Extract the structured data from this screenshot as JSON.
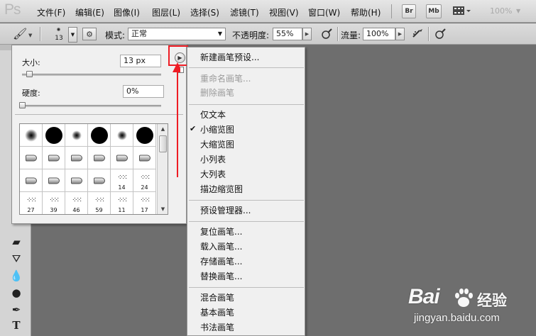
{
  "app": {
    "logo": "Ps"
  },
  "menubar": {
    "items": [
      "文件(F)",
      "编辑(E)",
      "图像(I)",
      "图层(L)",
      "选择(S)",
      "滤镜(T)",
      "视图(V)",
      "窗口(W)",
      "帮助(H)"
    ],
    "bridge_label": "Br",
    "minibridge_label": "Mb",
    "zoom": "100%"
  },
  "options": {
    "brush_size": "13",
    "mode_label": "模式:",
    "mode_value": "正常",
    "opacity_label": "不透明度:",
    "opacity_value": "55%",
    "flow_label": "流量:",
    "flow_value": "100%"
  },
  "brush_panel": {
    "size_label": "大小:",
    "size_value": "13 px",
    "size_fraction": 0.05,
    "hardness_label": "硬度:",
    "hardness_value": "0%",
    "hardness_fraction": 0.0,
    "presets": [
      {
        "shape": "soft",
        "d": 18,
        "label": ""
      },
      {
        "shape": "hard",
        "d": 24,
        "label": ""
      },
      {
        "shape": "soft",
        "d": 14,
        "label": ""
      },
      {
        "shape": "hard",
        "d": 24,
        "label": ""
      },
      {
        "shape": "soft",
        "d": 14,
        "label": ""
      },
      {
        "shape": "hard",
        "d": 24,
        "label": ""
      },
      {
        "shape": "tip",
        "label": ""
      },
      {
        "shape": "tip",
        "label": ""
      },
      {
        "shape": "tip",
        "label": ""
      },
      {
        "shape": "tip",
        "label": ""
      },
      {
        "shape": "tip",
        "label": ""
      },
      {
        "shape": "tip",
        "label": ""
      },
      {
        "shape": "tip",
        "label": ""
      },
      {
        "shape": "tip",
        "label": ""
      },
      {
        "shape": "tip",
        "label": ""
      },
      {
        "shape": "tip",
        "label": ""
      },
      {
        "shape": "spatter",
        "label": "14"
      },
      {
        "shape": "spatter",
        "label": "24"
      },
      {
        "shape": "spatter",
        "label": "27"
      },
      {
        "shape": "spatter",
        "label": "39"
      },
      {
        "shape": "spatter",
        "label": "46"
      },
      {
        "shape": "spatter",
        "label": "59"
      },
      {
        "shape": "spatter",
        "label": "11"
      },
      {
        "shape": "spatter",
        "label": "17"
      }
    ]
  },
  "flyout_menu": {
    "items": [
      {
        "label": "新建画笔预设...",
        "enabled": true,
        "checked": false
      },
      {
        "label": "重命名画笔...",
        "enabled": false,
        "checked": false
      },
      {
        "label": "删除画笔",
        "enabled": false,
        "checked": false
      },
      {
        "label": "仅文本",
        "enabled": true,
        "checked": false
      },
      {
        "label": "小缩览图",
        "enabled": true,
        "checked": true
      },
      {
        "label": "大缩览图",
        "enabled": true,
        "checked": false
      },
      {
        "label": "小列表",
        "enabled": true,
        "checked": false
      },
      {
        "label": "大列表",
        "enabled": true,
        "checked": false
      },
      {
        "label": "描边缩览图",
        "enabled": true,
        "checked": false
      },
      {
        "label": "预设管理器...",
        "enabled": true,
        "checked": false
      },
      {
        "label": "复位画笔...",
        "enabled": true,
        "checked": false
      },
      {
        "label": "载入画笔...",
        "enabled": true,
        "checked": false
      },
      {
        "label": "存储画笔...",
        "enabled": true,
        "checked": false
      },
      {
        "label": "替换画笔...",
        "enabled": true,
        "checked": false
      },
      {
        "label": "混合画笔",
        "enabled": true,
        "checked": false
      },
      {
        "label": "基本画笔",
        "enabled": true,
        "checked": false
      },
      {
        "label": "书法画笔",
        "enabled": true,
        "checked": false
      }
    ],
    "check_glyph": "✔"
  },
  "watermark": {
    "brand": "Bai",
    "brand_cn": "经验",
    "url": "jingyan.baidu.com"
  },
  "colors": {
    "annotation_red": "#ee1c24",
    "canvas_gray": "#6e6e6e"
  }
}
